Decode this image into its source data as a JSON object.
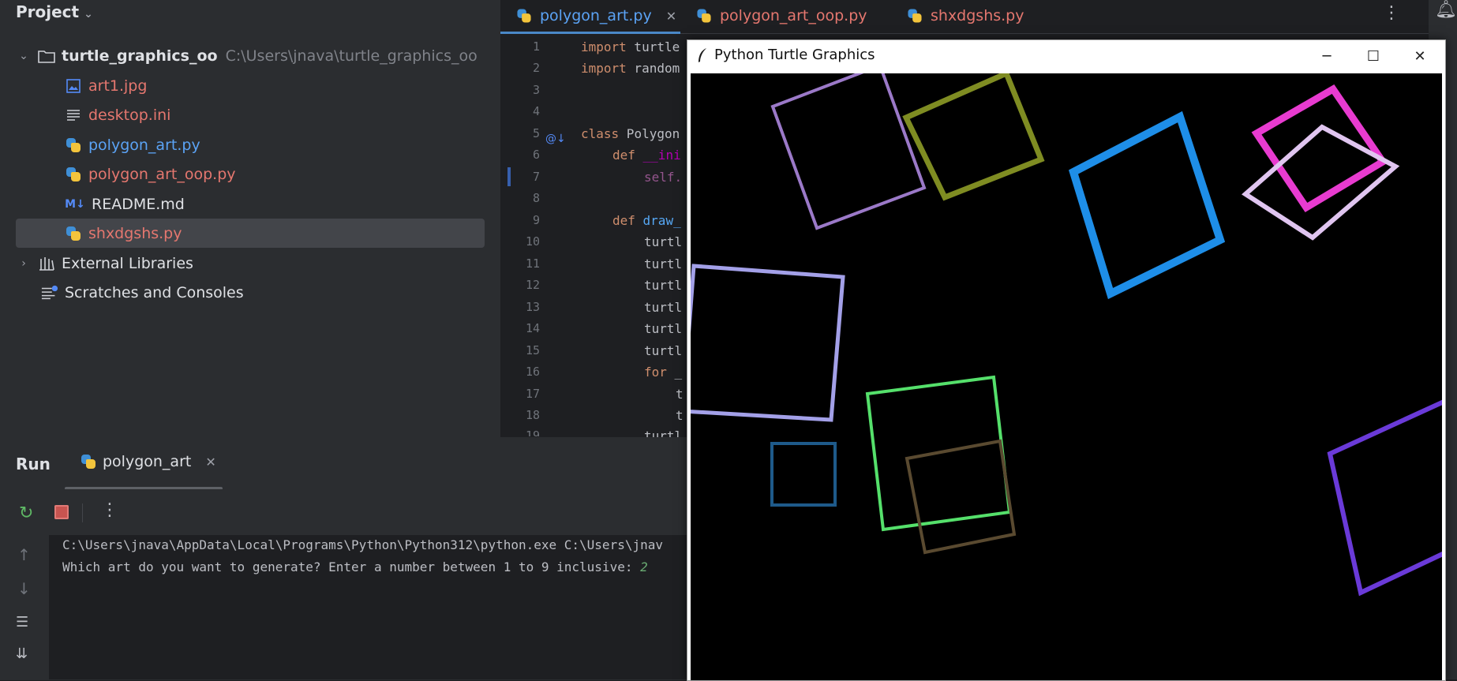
{
  "project_panel": {
    "title": "Project",
    "root": {
      "name": "turtle_graphics_oo",
      "path": "C:\\Users\\jnava\\turtle_graphics_oo"
    },
    "files": [
      {
        "name": "art1.jpg",
        "icon": "image-icon"
      },
      {
        "name": "desktop.ini",
        "icon": "text-file-icon"
      },
      {
        "name": "polygon_art.py",
        "icon": "python-file-icon"
      },
      {
        "name": "polygon_art_oop.py",
        "icon": "python-file-icon"
      },
      {
        "name": "README.md",
        "icon": "markdown-file-icon"
      },
      {
        "name": "shxdgshs.py",
        "icon": "python-file-icon"
      }
    ],
    "external_libraries": "External Libraries",
    "scratches": "Scratches and Consoles"
  },
  "editor": {
    "tabs": [
      {
        "label": "polygon_art.py",
        "active": true
      },
      {
        "label": "polygon_art_oop.py",
        "active": false
      },
      {
        "label": "shxdgshs.py",
        "active": false
      }
    ],
    "line_numbers": [
      "1",
      "2",
      "3",
      "4",
      "5",
      "6",
      "7",
      "8",
      "9",
      "10",
      "11",
      "12",
      "13",
      "14",
      "15",
      "16",
      "17",
      "18",
      "19"
    ],
    "code": {
      "l1_kw": "import",
      "l1_rest": " turtle",
      "l2_kw": "import",
      "l2_rest": " random",
      "l5_kw": "class",
      "l5_rest": " Polygon",
      "l6_kw": "def",
      "l6_rest": " __ini",
      "l7": "self.",
      "l9_kw": "def",
      "l9_rest": " draw_",
      "turtle_prefix": "turtl",
      "l16_kw": "for",
      "l16_rest": " _",
      "inner": "t"
    }
  },
  "run_panel": {
    "title": "Run",
    "tab_label": "polygon_art",
    "console": {
      "line1": "C:\\Users\\jnava\\AppData\\Local\\Programs\\Python\\Python312\\python.exe C:\\Users\\jnav",
      "line2_prompt": "Which art do you want to generate? Enter a number between 1 to 9 inclusive: ",
      "line2_input": "2"
    }
  },
  "turtle_window": {
    "title": "Python Turtle Graphics",
    "minimize": "─",
    "maximize": "☐",
    "close": "✕"
  },
  "colors": {
    "background": "#1e1f22",
    "panel": "#2b2d30",
    "accent": "#4a88c7",
    "file_red": "#e5776f",
    "file_blue": "#5ba3f5"
  }
}
